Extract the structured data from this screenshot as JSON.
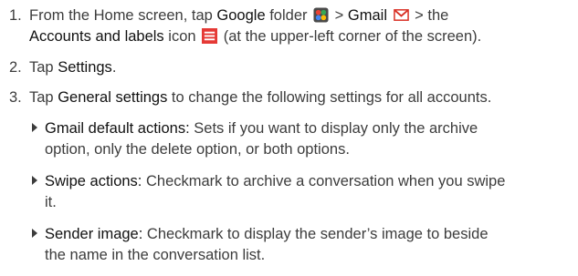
{
  "steps": [
    {
      "num": "1.",
      "l1_a": "From the Home screen, tap ",
      "l1_google": "Google",
      "l1_b": " folder",
      "l1_c": " > ",
      "l1_gmail": "Gmail",
      "l1_d": " > the",
      "l2_accounts": "Accounts and labels",
      "l2_a": " icon",
      "l2_b": " (at the upper-left corner of the screen)."
    },
    {
      "num": "2.",
      "a": "Tap ",
      "b": "Settings",
      "c": "."
    },
    {
      "num": "3.",
      "a": "Tap ",
      "b": "General settings",
      "c": " to change the following settings for all accounts."
    }
  ],
  "bullets": [
    {
      "term": "Gmail default actions:",
      "l1": " Sets if you want to display only the archive",
      "l2": "option, only the delete option, or both options."
    },
    {
      "term": "Swipe actions:",
      "l1": " Checkmark to archive a conversation when you swipe",
      "l2": "it."
    },
    {
      "term": "Sender image:",
      "l1": " Checkmark to display the sender’s image to beside",
      "l2": "the name in the conversation list."
    }
  ],
  "icons": {
    "folder": "google-folder-icon",
    "gmail": "gmail-icon",
    "menu": "accounts-labels-menu-icon"
  },
  "colors": {
    "text": "#3c3c3c",
    "emphasis": "#111111",
    "gmail_red": "#d93025",
    "menu_red": "#e53935"
  }
}
